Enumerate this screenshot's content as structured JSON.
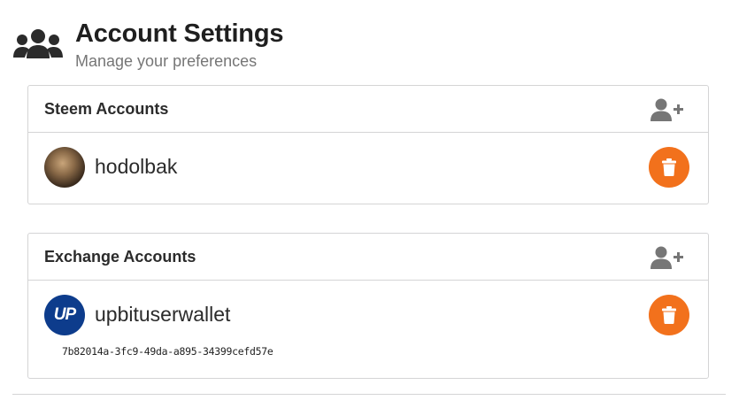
{
  "header": {
    "title": "Account Settings",
    "subtitle": "Manage your preferences",
    "icon": "users-icon"
  },
  "steem_accounts": {
    "title": "Steem Accounts",
    "add_icon": "user-plus-icon",
    "accounts": [
      {
        "name": "hodolbak",
        "avatar": "user-photo",
        "delete_icon": "trash-icon"
      }
    ]
  },
  "exchange_accounts": {
    "title": "Exchange Accounts",
    "add_icon": "user-plus-icon",
    "accounts": [
      {
        "name": "upbituserwallet",
        "avatar_text": "UP",
        "wallet_id": "7b82014a-3fc9-49da-a895-34399cefd57e",
        "delete_icon": "trash-icon"
      }
    ]
  },
  "colors": {
    "accent_orange": "#f2711c",
    "upbit_blue": "#0d3c8c",
    "border": "#d4d4d5",
    "icon_gray": "#767676"
  }
}
